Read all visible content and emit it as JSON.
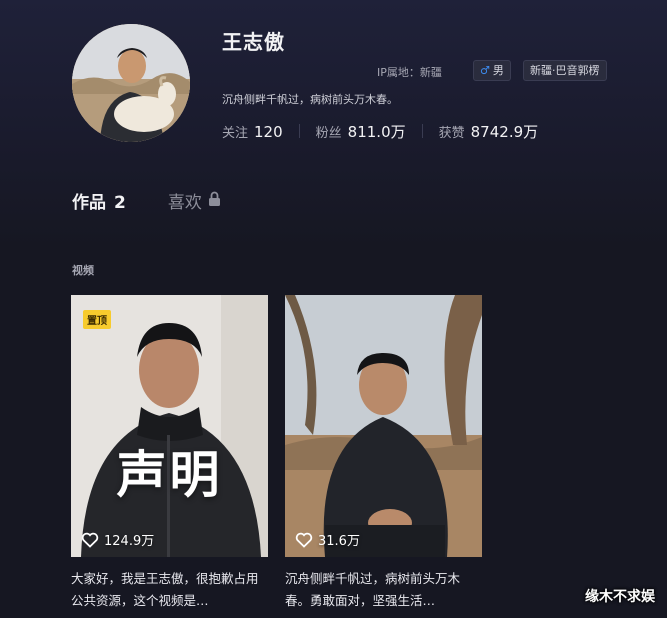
{
  "profile": {
    "name": "王志傲",
    "ip_label": "IP属地：",
    "ip_value": "新疆",
    "gender_icon": "male-icon",
    "gender_symbol": "♂",
    "gender": "男",
    "location_tag": "新疆·巴音郭楞",
    "bio": "沉舟侧畔千帆过，病树前头万木春。",
    "stats": {
      "following_label": "关注",
      "following_value": "120",
      "followers_label": "粉丝",
      "followers_value": "811.0万",
      "likes_label": "获赞",
      "likes_value": "8742.9万"
    }
  },
  "tabs": {
    "works_label": "作品",
    "works_count": "2",
    "likes_label": "喜欢"
  },
  "section": {
    "label": "视频"
  },
  "videos": [
    {
      "badge": "置顶",
      "overlay_text": "声明",
      "likes": "124.9万",
      "caption": "大家好，我是王志傲，很抱歉占用公共资源，这个视频是…"
    },
    {
      "likes": "31.6万",
      "caption": "沉舟侧畔千帆过，病树前头万木春。勇敢面对，坚强生活…"
    }
  ],
  "watermark": "缘木不求娱",
  "colors": {
    "background": "#161722",
    "pin_badge": "#f7cb2d",
    "male_blue": "#3d8cf0"
  }
}
